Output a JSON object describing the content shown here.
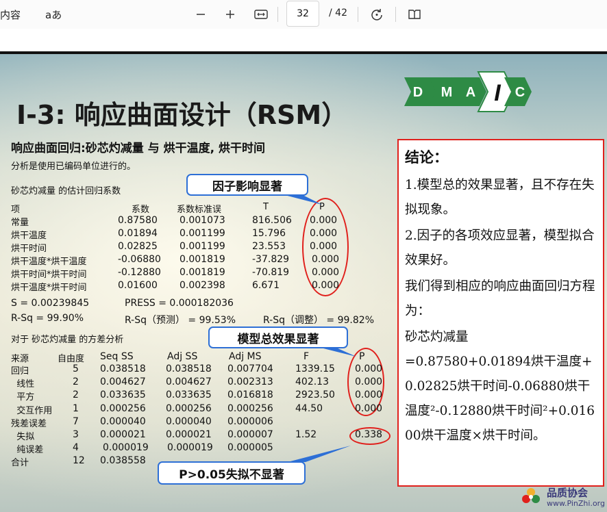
{
  "toolbar": {
    "contents_label": "内容",
    "read_aloud_label": "aあ",
    "page_current": "32",
    "page_total": "/ 42",
    "icons": [
      "zoom-out-icon",
      "zoom-in-icon",
      "fit-width-icon",
      "rotate-icon",
      "two-page-icon"
    ]
  },
  "slide": {
    "title": "I-3: 响应曲面设计（RSM）",
    "dmaic_letters": [
      "D",
      "M",
      "A",
      "I",
      "C"
    ],
    "subtitle": "响应曲面回归:砂芯灼减量 与 烘干温度, 烘干时间",
    "note": "分析是使用已编码单位进行的。",
    "coef_heading": "砂芯灼减量 的估计回归系数",
    "coef_headers": [
      "项",
      "系数",
      "系数标准误",
      "T",
      "P"
    ],
    "coef_rows": [
      [
        "常量",
        "0.87580",
        "0.001073",
        "816.506",
        "0.000"
      ],
      [
        "烘干温度",
        "0.01894",
        "0.001199",
        "15.796",
        "0.000"
      ],
      [
        "烘干时间",
        "0.02825",
        "0.001199",
        "23.553",
        "0.000"
      ],
      [
        "烘干温度*烘干温度",
        "-0.06880",
        "0.001819",
        "-37.829",
        "0.000"
      ],
      [
        "烘干时间*烘干时间",
        "-0.12880",
        "0.001819",
        "-70.819",
        "0.000"
      ],
      [
        "烘干温度*烘干时间",
        "0.01600",
        "0.002398",
        "6.671",
        "0.000"
      ]
    ],
    "s_line": "S = 0.00239845",
    "press_line": "PRESS = 0.000182036",
    "rsq": "R-Sq = 99.90%",
    "rsq_pred": "R-Sq（预测） = 99.53%",
    "rsq_adj": "R-Sq（调整） = 99.82%",
    "anova_heading": "对于  砂芯灼减量  的方差分析",
    "anova_headers": [
      "来源",
      "自由度",
      "Seq SS",
      "Adj SS",
      "Adj MS",
      "F",
      "P"
    ],
    "anova_rows": [
      [
        "回归",
        "5",
        "0.038518",
        "0.038518",
        "0.007704",
        "1339.15",
        "0.000"
      ],
      [
        "  线性",
        "2",
        "0.004627",
        "0.004627",
        "0.002313",
        "402.13",
        "0.000"
      ],
      [
        "  平方",
        "2",
        "0.033635",
        "0.033635",
        "0.016818",
        "2923.50",
        "0.000"
      ],
      [
        "  交互作用",
        "1",
        "0.000256",
        "0.000256",
        "0.000256",
        "44.50",
        "0.000"
      ],
      [
        "残差误差",
        "7",
        "0.000040",
        "0.000040",
        "0.000006",
        "",
        ""
      ],
      [
        "  失拟",
        "3",
        "0.000021",
        "0.000021",
        "0.000007",
        "1.52",
        "0.338"
      ],
      [
        "  纯误差",
        "4",
        "0.000019",
        "0.000019",
        "0.000005",
        "",
        ""
      ],
      [
        "合计",
        "12",
        "0.038558",
        "",
        "",
        "",
        ""
      ]
    ],
    "callout_factor": "因子影响显著",
    "callout_model": "模型总效果显著",
    "callout_lof": "P>0.05失拟不显著",
    "conclusion": {
      "heading": "结论：",
      "p1": "1.模型总的效果显著，且不存在失拟现象。",
      "p2": "2.因子的各项效应显著，模型拟合效果好。",
      "p3": "我们得到相应的响应曲面回归方程为：",
      "p4a": "砂芯灼减量",
      "p4b": "=0.87580+0.01894烘干温度+0.02825烘干时间-0.06880烘干温度²-0.12880烘干时间²+0.01600烘干温度×烘干时间。"
    },
    "logo_name": "品质协会",
    "logo_url": "www.PinZhi.org"
  },
  "colors": {
    "callout_border": "#2d6fd6",
    "highlight_red": "#e0201c",
    "dmaic_green": "#2e8b45"
  }
}
